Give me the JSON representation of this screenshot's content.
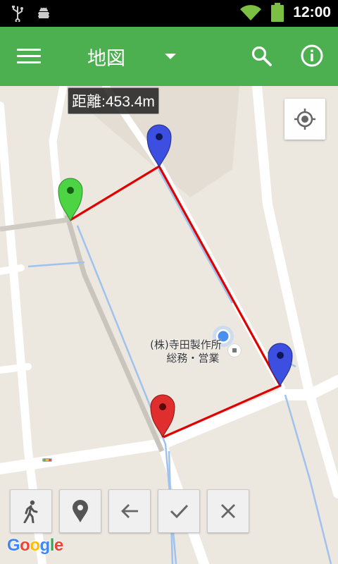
{
  "status_bar": {
    "time": "12:00",
    "icons": [
      "usb-icon",
      "android-debug-icon",
      "wifi-icon",
      "battery-icon"
    ]
  },
  "app_bar": {
    "title": "地図",
    "icons": [
      "menu-icon",
      "dropdown-icon",
      "search-icon",
      "info-icon"
    ],
    "color": "#4caf50"
  },
  "map": {
    "distance_label": "距離:453.4m",
    "poi": {
      "line1": "(株)寺田製作所",
      "line2": "総務・営業"
    },
    "markers": [
      {
        "color": "green",
        "hex": "#4cd444"
      },
      {
        "color": "blue",
        "hex": "#3c4fe0"
      },
      {
        "color": "blue",
        "hex": "#3c4fe0"
      },
      {
        "color": "red",
        "hex": "#e02e2e"
      }
    ],
    "route_color": "#e00000",
    "locate_button": "my-location-icon"
  },
  "toolbar": {
    "buttons": [
      "walk-icon",
      "place-icon",
      "back-arrow-icon",
      "check-icon",
      "close-icon"
    ]
  },
  "attribution": {
    "letters": [
      "G",
      "o",
      "o",
      "g",
      "l",
      "e"
    ],
    "colors": [
      "#4285f4",
      "#ea4335",
      "#fbbc05",
      "#4285f4",
      "#34a853",
      "#ea4335"
    ]
  }
}
